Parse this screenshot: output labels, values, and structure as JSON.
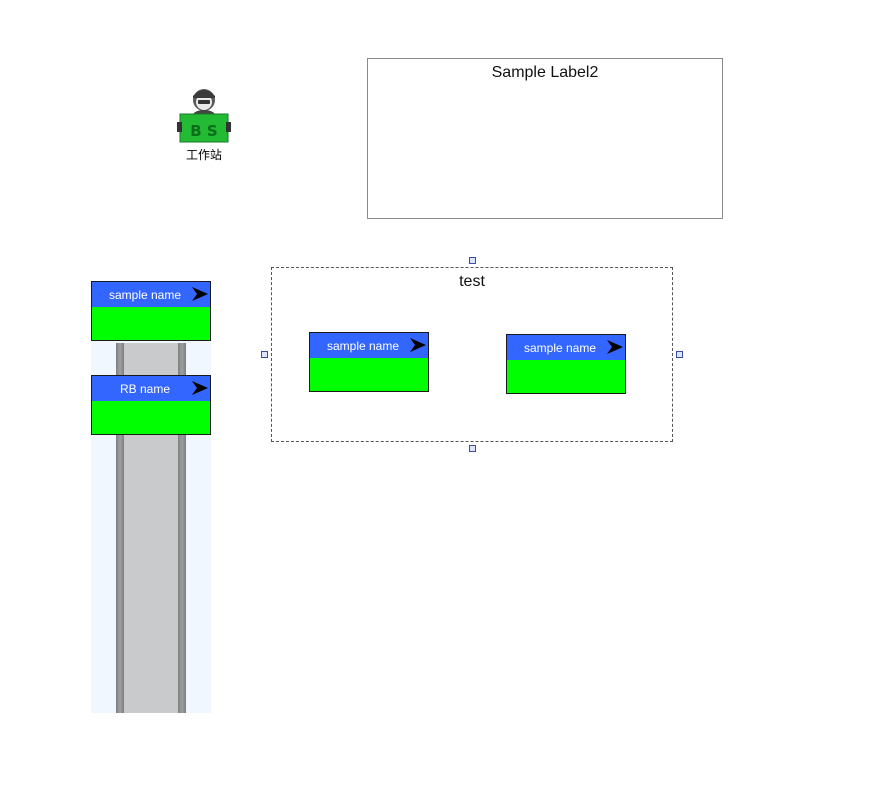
{
  "workstation": {
    "label": "工作站",
    "badge_text": "B S",
    "icon": "operator-icon",
    "badge_color": "#22bb33"
  },
  "label_box": {
    "title": "Sample Label2"
  },
  "conveyor": {
    "cards": [
      {
        "name": "sample name"
      },
      {
        "name": "RB name"
      }
    ]
  },
  "group": {
    "title": "test",
    "cards": [
      {
        "name": "sample name"
      },
      {
        "name": "sample name"
      }
    ]
  },
  "colors": {
    "card_header": "#3366ff",
    "card_body": "#00ff00",
    "conveyor_bg": "#f0f7ff",
    "belt": "#c9cacb"
  }
}
